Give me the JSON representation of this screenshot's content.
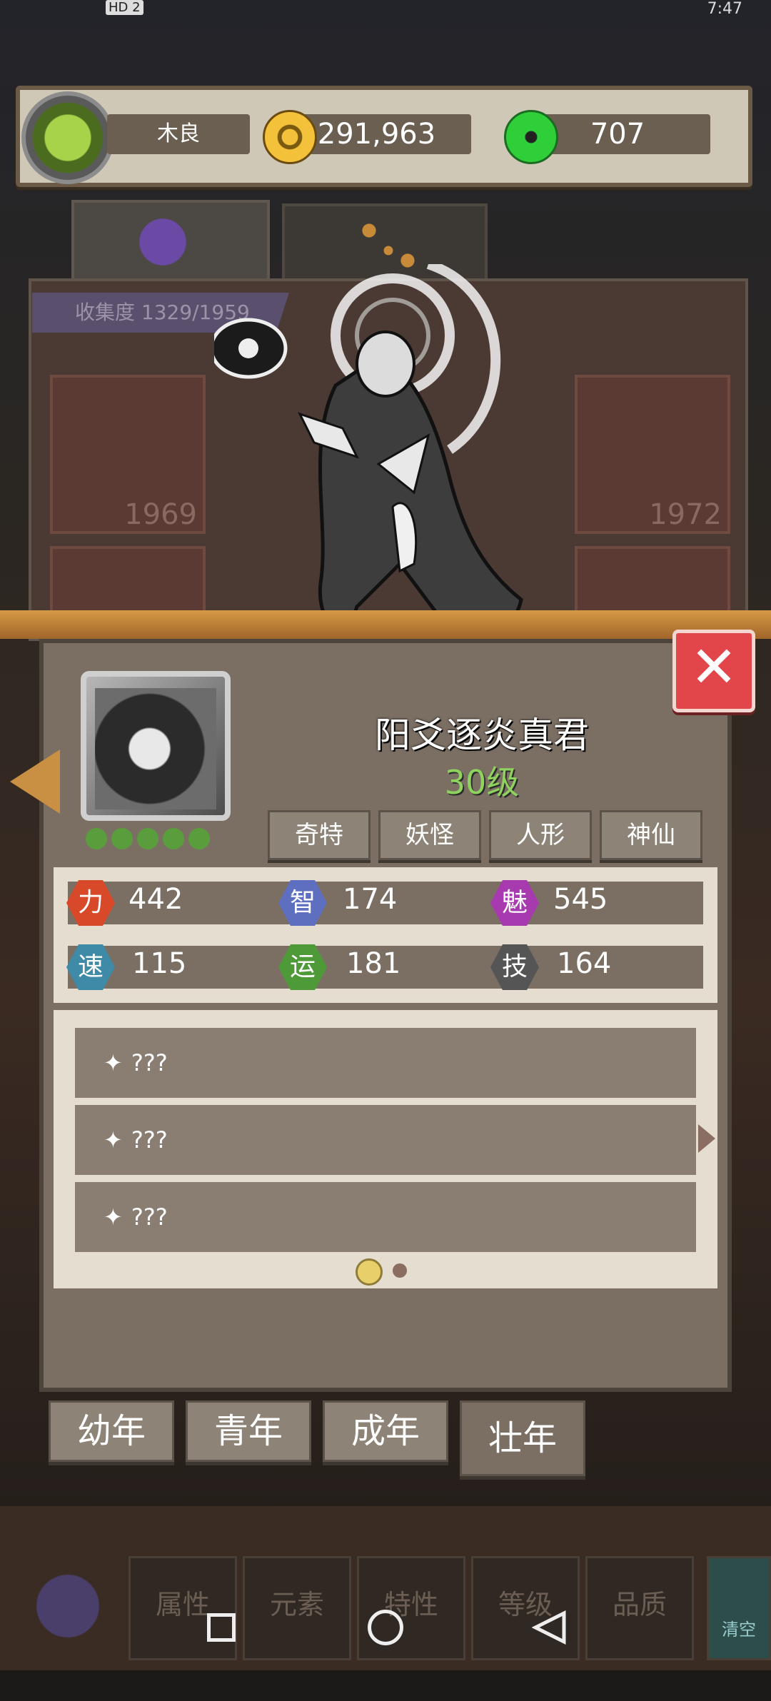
{
  "status_bar": {
    "hd": "HD 2",
    "clock": "7:47"
  },
  "resources": {
    "player_name": "木良",
    "coins": "291,963",
    "gems": "707"
  },
  "collection": {
    "label": "收集度 1329/1959",
    "card_numbers": [
      "1969",
      "1972"
    ]
  },
  "hero": {
    "name": "阳爻逐炎真君",
    "level": "30级",
    "tags": [
      "奇特",
      "妖怪",
      "人形",
      "神仙"
    ],
    "close_label": "✕"
  },
  "stats": [
    {
      "icon": "力",
      "value": "442",
      "color": "#d8492a"
    },
    {
      "icon": "智",
      "value": "174",
      "color": "#5f6fbf"
    },
    {
      "icon": "魅",
      "value": "545",
      "color": "#a83ab0"
    },
    {
      "icon": "速",
      "value": "115",
      "color": "#3f8aa6"
    },
    {
      "icon": "运",
      "value": "181",
      "color": "#4e9a38"
    },
    {
      "icon": "技",
      "value": "164",
      "color": "#555555"
    }
  ],
  "skills": [
    "???",
    "???",
    "???"
  ],
  "age_tabs": [
    "幼年",
    "青年",
    "成年",
    "壮年"
  ],
  "bottom_buttons": [
    "属性",
    "元素",
    "特性",
    "等级",
    "品质"
  ],
  "bottom_right": "清空"
}
